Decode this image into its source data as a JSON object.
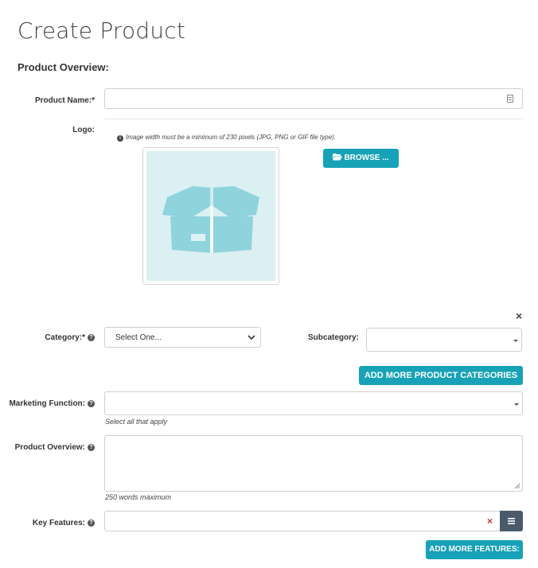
{
  "page": {
    "title": "Create Product"
  },
  "section": {
    "title": "Product Overview:"
  },
  "fields": {
    "product_name": {
      "label": "Product Name:*",
      "value": ""
    },
    "logo": {
      "label": "Logo:",
      "info": "Image width must be a minimum of 230 pixels (JPG, PNG or GIF file type).",
      "browse_label": "BROWSE ..."
    },
    "category": {
      "label": "Category:*",
      "selected": "Select One..."
    },
    "subcategory": {
      "label": "Subcategory:",
      "selected": ""
    },
    "add_categories_label": "ADD MORE PRODUCT CATEGORIES",
    "marketing_function": {
      "label": "Marketing Function:",
      "hint": "Select all that apply",
      "selected": ""
    },
    "product_overview": {
      "label": "Product Overview:",
      "hint": "250 words maximum",
      "value": ""
    },
    "key_features": {
      "label": "Key Features:",
      "value": ""
    },
    "add_features_label": "ADD MORE FEATURES:"
  },
  "colors": {
    "accent": "#17a2b8",
    "placeholder_bg": "#daf0f2",
    "placeholder_box": "#8fd3dc",
    "clear_red": "#c9302c",
    "list_button": "#4a5a6a"
  },
  "icons": {
    "info": "info-circle-icon",
    "browse": "folder-open-icon",
    "help": "question-circle-icon",
    "close": "close-icon",
    "clear": "clear-x-icon",
    "list": "list-icon",
    "contact": "contact-card-icon"
  }
}
